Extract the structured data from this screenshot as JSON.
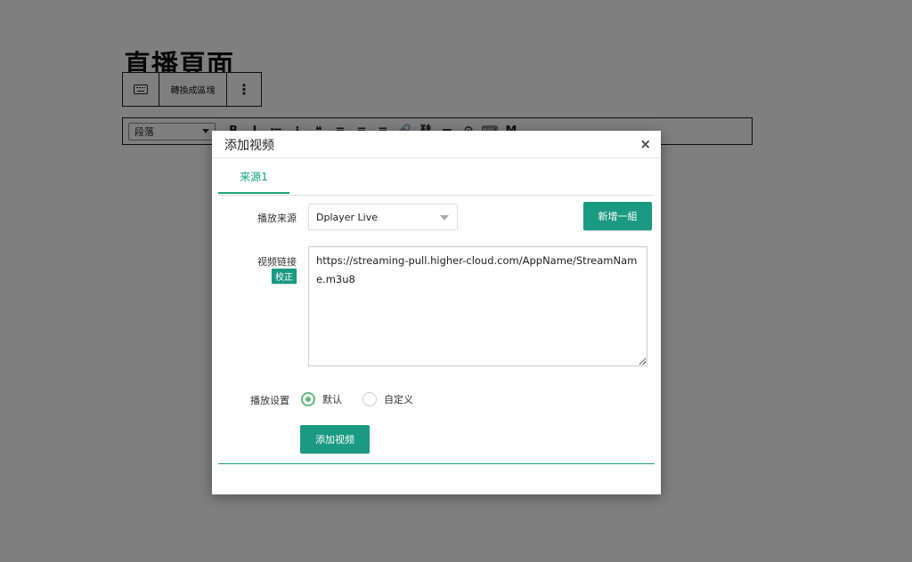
{
  "editor": {
    "page_title": "直播頁面",
    "block_toolbar": {
      "convert_label": "轉換成區塊",
      "more_label": "⋮"
    },
    "format_select": "段落",
    "format_icons": [
      "B",
      "I",
      "≔",
      "⁝",
      "❝",
      "≡",
      "≡",
      "≡",
      "🔗",
      "⛓",
      "▬",
      "⚙",
      "⌨",
      "M"
    ]
  },
  "modal": {
    "title": "添加视频",
    "close_label": "×",
    "tabs": [
      {
        "label": "来源1",
        "active": true
      }
    ],
    "source_label": "播放来源",
    "source_value": "Dplayer Live",
    "add_group_label": "新增一組",
    "link_label": "视频链接",
    "fix_label": "校正",
    "link_value": "https://streaming-pull.higher-cloud.com/AppName/StreamName.m3u8",
    "settings_label": "播放设置",
    "options": [
      {
        "label": "默认",
        "checked": true
      },
      {
        "label": "自定义",
        "checked": false
      }
    ],
    "submit_label": "添加视频"
  },
  "colors": {
    "accent": "#1a9a80",
    "radio": "#5fb878",
    "overlay": "rgba(0,0,0,0.5)"
  }
}
